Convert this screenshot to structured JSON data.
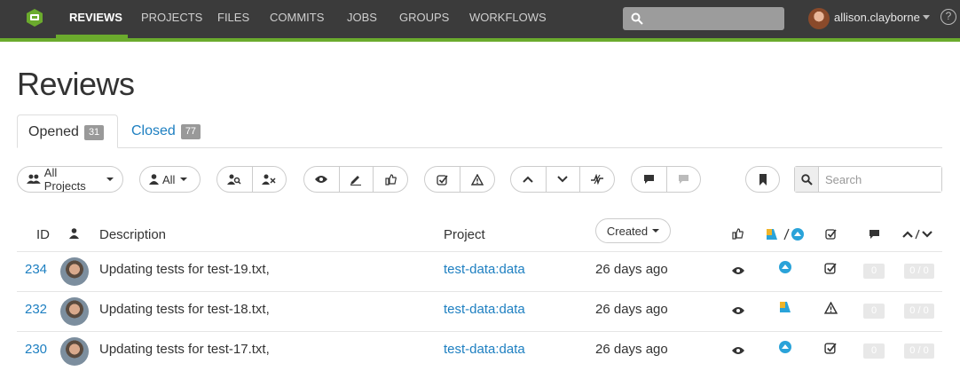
{
  "nav": {
    "items": [
      "REVIEWS",
      "PROJECTS",
      "FILES",
      "COMMITS",
      "JOBS",
      "GROUPS",
      "WORKFLOWS"
    ],
    "active_index": 0,
    "username": "allison.clayborne",
    "help": "?",
    "accent_color": "#6bab2d"
  },
  "page": {
    "title": "Reviews"
  },
  "tabs": [
    {
      "label": "Opened",
      "count": "31"
    },
    {
      "label": "Closed",
      "count": "77"
    }
  ],
  "filters": {
    "projects_label": "All Projects",
    "author_label": "All",
    "search_placeholder": "Search"
  },
  "table": {
    "headers": {
      "id": "ID",
      "description": "Description",
      "project": "Project",
      "sort_label": "Created"
    },
    "rows": [
      {
        "id": "234",
        "description": "Updating tests for test-19.txt,",
        "project": "test-data:data",
        "created": "26 days ago",
        "status_icon": "up-circle-icon",
        "test_icon": "check-icon",
        "comments": "0",
        "votes": "0 / 0"
      },
      {
        "id": "232",
        "description": "Updating tests for test-18.txt,",
        "project": "test-data:data",
        "created": "26 days ago",
        "status_icon": "needs-review-icon",
        "test_icon": "warning-icon",
        "comments": "0",
        "votes": "0 / 0"
      },
      {
        "id": "230",
        "description": "Updating tests for test-17.txt,",
        "project": "test-data:data",
        "created": "26 days ago",
        "status_icon": "up-circle-icon",
        "test_icon": "check-icon",
        "comments": "0",
        "votes": "0 / 0"
      }
    ]
  }
}
